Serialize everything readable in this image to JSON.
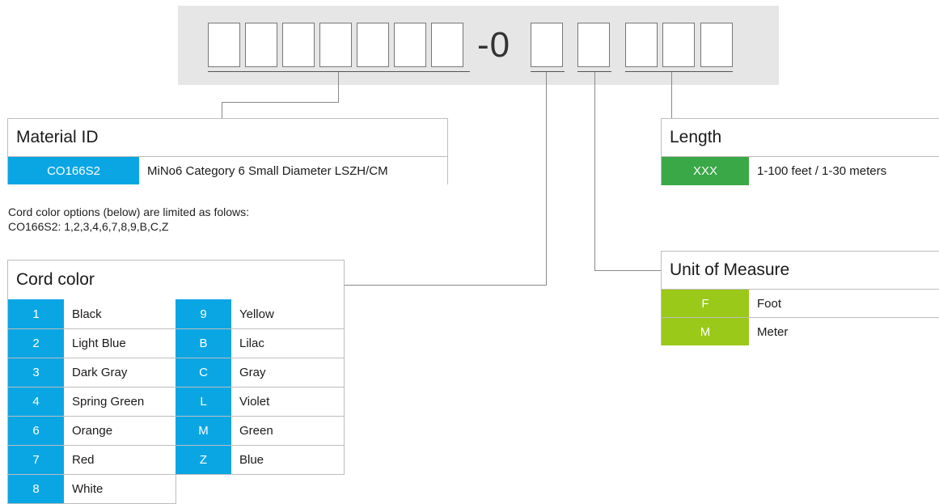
{
  "part_number": {
    "separator": "-0"
  },
  "material": {
    "title": "Material ID",
    "code": "CO166S2",
    "description": "MiNo6 Category 6 Small Diameter LSZH/CM"
  },
  "note": {
    "line1": "Cord color options (below) are limited as folows:",
    "line2": "CO166S2: 1,2,3,4,6,7,8,9,B,C,Z"
  },
  "cord_color": {
    "title": "Cord color",
    "left": [
      {
        "code": "1",
        "name": "Black"
      },
      {
        "code": "2",
        "name": "Light Blue"
      },
      {
        "code": "3",
        "name": "Dark Gray"
      },
      {
        "code": "4",
        "name": "Spring Green"
      },
      {
        "code": "6",
        "name": "Orange"
      },
      {
        "code": "7",
        "name": "Red"
      },
      {
        "code": "8",
        "name": "White"
      }
    ],
    "right": [
      {
        "code": "9",
        "name": "Yellow"
      },
      {
        "code": "B",
        "name": "Lilac"
      },
      {
        "code": "C",
        "name": "Gray"
      },
      {
        "code": "L",
        "name": "Violet"
      },
      {
        "code": "M",
        "name": "Green"
      },
      {
        "code": "Z",
        "name": "Blue"
      }
    ]
  },
  "unit": {
    "title": "Unit of Measure",
    "rows": [
      {
        "code": "F",
        "name": "Foot"
      },
      {
        "code": "M",
        "name": "Meter"
      }
    ]
  },
  "length": {
    "title": "Length",
    "code": "XXX",
    "description": "1-100 feet / 1-30 meters"
  },
  "colors": {
    "blue": "#0aa6e4",
    "lime": "#9bc919",
    "green": "#3aa847"
  }
}
